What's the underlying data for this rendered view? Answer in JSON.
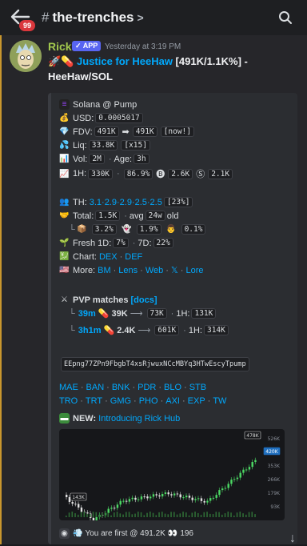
{
  "header": {
    "unread_badge": "99",
    "channel_name": "the-trenches",
    "channel_hash": "#",
    "chevron": ">"
  },
  "message": {
    "username": "Rick",
    "app_tag": "✓ APP",
    "timestamp": "Yesterday at 3:19 PM",
    "headline_link": "Justice for HeeHaw",
    "headline_rest": " [491K/1.1K%] -",
    "headline_pair": "HeeHaw/SOL"
  },
  "embed": {
    "platform": "Solana @ Pump",
    "usd_label": "USD:",
    "usd_value": "0.0005017",
    "fdv_label": "FDV:",
    "fdv_from": "491K",
    "fdv_to": "491K",
    "fdv_now": "[now!]",
    "liq_label": "Liq:",
    "liq_value": "33.8K",
    "liq_mult": "[x15]",
    "vol_label": "Vol:",
    "vol_value": "2M",
    "age_label": "Age:",
    "age_value": "3h",
    "h1_label": "1H:",
    "h1_value": "330K",
    "h1_pct": "86.9%",
    "b_value": "2.6K",
    "s_value": "2.1K",
    "th_label": "TH:",
    "th_values": "3.1·2.9·2.9·2.5·2.5",
    "th_pct": "[23%]",
    "total_label": "Total:",
    "total_value": "1.5K",
    "avg_label": "avg",
    "avg_value": "24w",
    "avg_suffix": "old",
    "holder_pct1": "3.2%",
    "holder_pct2": "1.9%",
    "holder_pct3": "0.1%",
    "fresh_label": "Fresh 1D:",
    "fresh_value": "7%",
    "fresh7_label": "7D:",
    "fresh7_value": "22%",
    "chart_label": "Chart:",
    "chart_links": [
      "DEX",
      "DEF"
    ],
    "more_label": "More:",
    "more_links": [
      "BM",
      "Lens",
      "Web",
      "𝕏",
      "Lore"
    ],
    "pvp_title": "PVP matches",
    "pvp_docs": "[docs]",
    "pvp": [
      {
        "age": "39m",
        "fdv": "39K",
        "ath": "73K",
        "h1_label": "1H:",
        "h1": "131K"
      },
      {
        "age": "3h1m",
        "fdv": "2.4K",
        "ath": "601K",
        "h1_label": "1H:",
        "h1": "314K"
      }
    ],
    "contract": "EEpng77ZPn9FbgbT4xsRjwuxNCcMBYq3HTwEscyTpump",
    "bots_row1": [
      "MAE",
      "BAN",
      "BNK",
      "PDR",
      "BLO",
      "STB"
    ],
    "bots_row2": [
      "TRO",
      "TRT",
      "GMG",
      "PHO",
      "AXI",
      "EXP",
      "TW"
    ],
    "new_label": "NEW:",
    "new_link": "Introducing Rick Hub",
    "footer_text": "You are first @ 491.2K",
    "footer_eyes": "👀",
    "footer_count": "196"
  },
  "chart_data": {
    "type": "candlestick",
    "y_ticks": [
      "526K",
      "420K",
      "353K",
      "266K",
      "179K",
      "93K"
    ],
    "low_label": "143K",
    "high_label": "478K",
    "close_label": "420K"
  },
  "colors": {
    "username": "#a3c94e",
    "link": "#00a8fc",
    "app_tag": "#5865f2",
    "badge": "#da373c",
    "candle_up": "#4cd964",
    "candle_down": "#e0e0e0"
  }
}
